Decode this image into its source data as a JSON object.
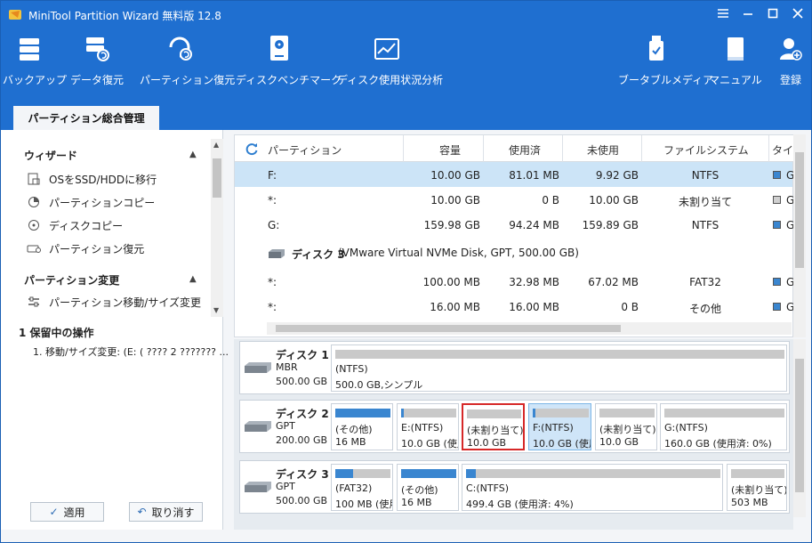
{
  "window": {
    "title": "MiniTool Partition Wizard 無料版 12.8"
  },
  "toolbar": {
    "backup": "バックアップ",
    "data_recovery": "データ復元",
    "partition_recovery": "パーティション復元",
    "benchmark": "ディスクベンチマーク",
    "space_analyzer": "ディスク使用状況分析",
    "bootable_media": "ブータブルメディア",
    "manual": "マニュアル",
    "register": "登録"
  },
  "tab": {
    "main": "パーティション総合管理"
  },
  "sidebar": {
    "wizard_title": "ウィザード",
    "wizard_items": [
      "OSをSSD/HDDに移行",
      "パーティションコピー",
      "ディスクコピー",
      "パーティション復元"
    ],
    "change_title": "パーティション変更",
    "change_items": [
      "パーティション移動/サイズ変更"
    ],
    "pending_title": "1 保留中の操作",
    "pending_items": [
      "1. 移動/サイズ変更: (E: ( ???? 2 ??????? ..."
    ]
  },
  "actions": {
    "apply": "適用",
    "undo": "取り消す"
  },
  "table": {
    "headers": {
      "partition": "パーティション",
      "capacity": "容量",
      "used": "使用済",
      "unused": "未使用",
      "fs": "ファイルシステム",
      "type": "タイプ"
    },
    "rows": [
      {
        "partition": "F:",
        "capacity": "10.00 GB",
        "used": "81.01 MB",
        "unused": "9.92 GB",
        "fs": "NTFS",
        "type": "G"
      },
      {
        "partition": "*:",
        "capacity": "10.00 GB",
        "used": "0 B",
        "unused": "10.00 GB",
        "fs": "未割り当て",
        "type": "G"
      },
      {
        "partition": "G:",
        "capacity": "159.98 GB",
        "used": "94.24 MB",
        "unused": "159.89 GB",
        "fs": "NTFS",
        "type": "G"
      }
    ],
    "disk3_name": "ディスク 3",
    "disk3_desc": "(VMware Virtual NVMe Disk, GPT, 500.00 GB)",
    "rows2": [
      {
        "partition": "*:",
        "capacity": "100.00 MB",
        "used": "32.98 MB",
        "unused": "67.02 MB",
        "fs": "FAT32",
        "type": "G"
      },
      {
        "partition": "*:",
        "capacity": "16.00 MB",
        "used": "16.00 MB",
        "unused": "0 B",
        "fs": "その他",
        "type": "G"
      }
    ]
  },
  "diskmap": {
    "disk1": {
      "name": "ディスク 1",
      "type": "MBR",
      "size": "500.00 GB",
      "parts": [
        {
          "l1": "(NTFS)",
          "l2": "500.0 GB,シンプル",
          "fill": 0.0
        }
      ]
    },
    "disk2": {
      "name": "ディスク 2",
      "type": "GPT",
      "size": "200.00 GB",
      "parts": [
        {
          "l1": "(その他)",
          "l2": "16 MB",
          "fill": 1.0
        },
        {
          "l1": "E:(NTFS)",
          "l2": "10.0 GB (使用",
          "fill": 0.05
        },
        {
          "l1": "(未割り当て)",
          "l2": "10.0 GB",
          "fill": 0.0
        },
        {
          "l1": "F:(NTFS)",
          "l2": "10.0 GB (使用",
          "fill": 0.05
        },
        {
          "l1": "(未割り当て)",
          "l2": "10.0 GB",
          "fill": 0.0
        },
        {
          "l1": "G:(NTFS)",
          "l2": "160.0 GB (使用済: 0%)",
          "fill": 0.0
        }
      ]
    },
    "disk3": {
      "name": "ディスク 3",
      "type": "GPT",
      "size": "500.00 GB",
      "parts": [
        {
          "l1": "(FAT32)",
          "l2": "100 MB (使用",
          "fill": 0.33
        },
        {
          "l1": "(その他)",
          "l2": "16 MB",
          "fill": 1.0
        },
        {
          "l1": "C:(NTFS)",
          "l2": "499.4 GB (使用済: 4%)",
          "fill": 0.04
        },
        {
          "l1": "(未割り当て)",
          "l2": "503 MB",
          "fill": 0.0
        }
      ]
    }
  },
  "colors": {
    "titlebar": "#1f6fd0",
    "selection": "#cce4f7",
    "partition_fill": "#3a86d0",
    "highlight": "#d62828"
  }
}
